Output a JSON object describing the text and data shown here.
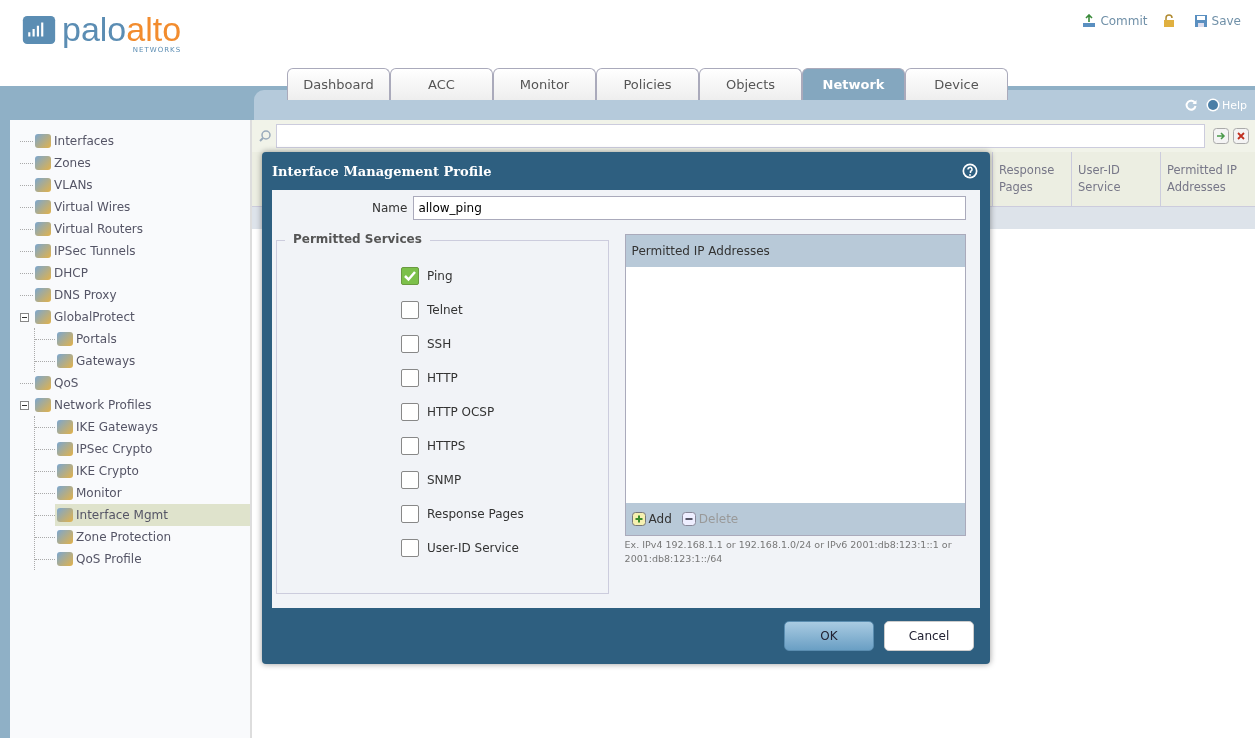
{
  "header": {
    "logo": {
      "text": "palo",
      "accent": "alto",
      "sub": "NETWORKS"
    },
    "tabs": [
      {
        "label": "Dashboard",
        "selected": false
      },
      {
        "label": "ACC",
        "selected": false
      },
      {
        "label": "Monitor",
        "selected": false
      },
      {
        "label": "Policies",
        "selected": false
      },
      {
        "label": "Objects",
        "selected": false
      },
      {
        "label": "Network",
        "selected": true
      },
      {
        "label": "Device",
        "selected": false
      }
    ],
    "actions": [
      {
        "label": "Commit",
        "kind": "commit"
      },
      {
        "label": "Save",
        "kind": "save"
      }
    ],
    "help": "Help"
  },
  "sidebar": {
    "items": [
      {
        "label": "Interfaces",
        "selected": false
      },
      {
        "label": "Zones",
        "selected": false
      },
      {
        "label": "VLANs",
        "selected": false
      },
      {
        "label": "Virtual Wires",
        "selected": false
      },
      {
        "label": "Virtual Routers",
        "selected": false
      },
      {
        "label": "IPSec Tunnels",
        "selected": false
      },
      {
        "label": "DHCP",
        "selected": false
      },
      {
        "label": "DNS Proxy",
        "selected": false
      },
      {
        "label": "GlobalProtect",
        "selected": false,
        "expanded": true,
        "children": [
          {
            "label": "Portals",
            "selected": false
          },
          {
            "label": "Gateways",
            "selected": false
          }
        ]
      },
      {
        "label": "QoS",
        "selected": false
      },
      {
        "label": "Network Profiles",
        "selected": false,
        "expanded": true,
        "children": [
          {
            "label": "IKE Gateways",
            "selected": false
          },
          {
            "label": "IPSec Crypto",
            "selected": false
          },
          {
            "label": "IKE Crypto",
            "selected": false
          },
          {
            "label": "Monitor",
            "selected": false
          },
          {
            "label": "Interface Mgmt",
            "selected": true
          },
          {
            "label": "Zone Protection",
            "selected": false
          },
          {
            "label": "QoS Profile",
            "selected": false
          }
        ]
      }
    ]
  },
  "table": {
    "columns": [
      "Response Pages",
      "User-ID Service",
      "Permitted IP Addresses"
    ]
  },
  "dialog": {
    "title": "Interface Management Profile",
    "name_label": "Name",
    "name_value": "allow_ping",
    "services_title": "Permitted Services",
    "services": [
      {
        "label": "Ping",
        "checked": true
      },
      {
        "label": "Telnet",
        "checked": false
      },
      {
        "label": "SSH",
        "checked": false
      },
      {
        "label": "HTTP",
        "checked": false
      },
      {
        "label": "HTTP OCSP",
        "checked": false
      },
      {
        "label": "HTTPS",
        "checked": false
      },
      {
        "label": "SNMP",
        "checked": false
      },
      {
        "label": "Response Pages",
        "checked": false
      },
      {
        "label": "User-ID Service",
        "checked": false
      }
    ],
    "ip_grid": {
      "column": "Permitted IP Addresses",
      "add": "Add",
      "delete": "Delete",
      "delete_disabled": true,
      "hint": "Ex. IPv4 192.168.1.1 or 192.168.1.0/24 or IPv6 2001:db8:123:1::1 or 2001:db8:123:1::/64"
    },
    "buttons": [
      {
        "label": "OK",
        "kind": "primary"
      },
      {
        "label": "Cancel",
        "kind": "secondary"
      }
    ]
  }
}
